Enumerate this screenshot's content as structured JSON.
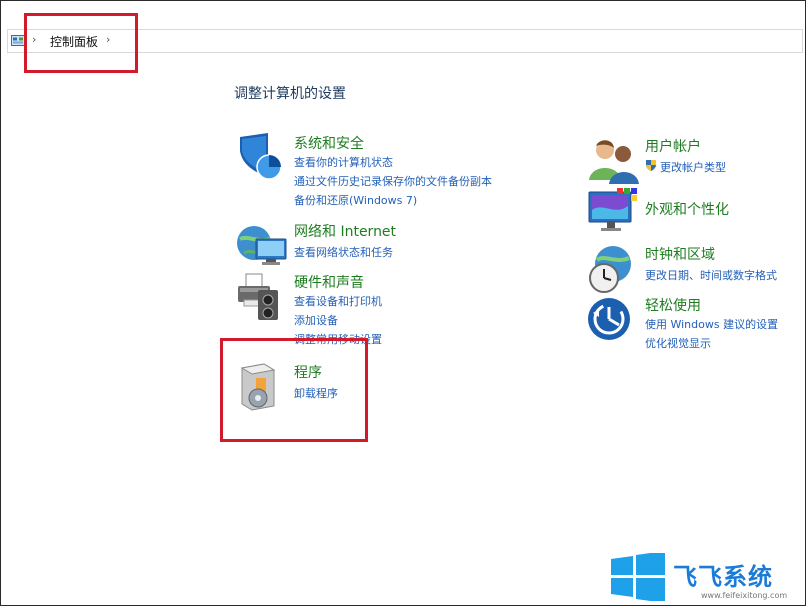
{
  "breadcrumb": {
    "current": "控制面板"
  },
  "main": {
    "heading": "调整计算机的设置",
    "categories": [
      {
        "title": "系统和安全",
        "links": [
          "查看你的计算机状态",
          "通过文件历史记录保存你的文件备份副本",
          "备份和还原(Windows 7)"
        ]
      },
      {
        "title": "网络和 Internet",
        "links": [
          "查看网络状态和任务"
        ]
      },
      {
        "title": "硬件和声音",
        "links": [
          "查看设备和打印机",
          "添加设备",
          "调整常用移动设置"
        ]
      },
      {
        "title": "程序",
        "links": [
          "卸载程序"
        ]
      },
      {
        "title": "用户帐户",
        "links": [
          "更改帐户类型"
        ]
      },
      {
        "title": "外观和个性化",
        "links": []
      },
      {
        "title": "时钟和区域",
        "links": [
          "更改日期、时间或数字格式"
        ]
      },
      {
        "title": "轻松使用",
        "links": [
          "使用 Windows 建议的设置",
          "优化视觉显示"
        ]
      }
    ]
  },
  "watermark": {
    "brand": "飞飞系统",
    "url": "www.feifeixitong.com"
  },
  "colors": {
    "title": "#1f7d21",
    "link": "#2360b8",
    "heading": "#1e3a5f",
    "highlight": "#d11b2c"
  }
}
